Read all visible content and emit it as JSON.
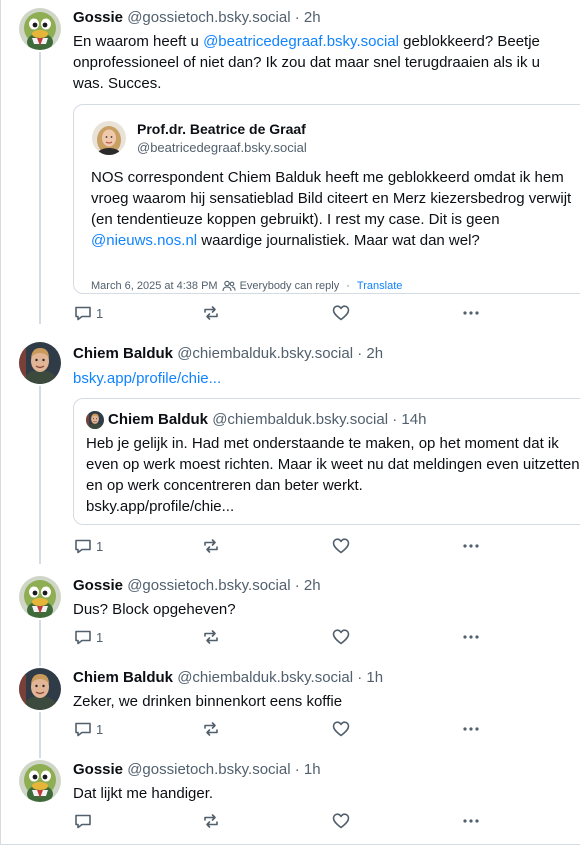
{
  "colors": {
    "accent": "#1083fe",
    "muted": "#52606d",
    "border": "#d4dbe2"
  },
  "posts": [
    {
      "name": "Gossie",
      "handle": "@gossietoch.bsky.social",
      "time": "2h",
      "text_parts": [
        "En waarom heeft u ",
        "@beatricedegraaf.bsky.social",
        " geblokkeerd? Beetje onprofessioneel of niet dan? Ik zou dat maar snel terugdraaien als ik u was. Succes."
      ],
      "quote": {
        "name": "Prof.dr. Beatrice de Graaf",
        "handle": "@beatricedegraaf.bsky.social",
        "text_parts": [
          "NOS correspondent Chiem Balduk heeft me geblokkeerd omdat ik hem vroeg waarom hij sensatieblad Bild citeert en Merz kiezersbedrog verwijt (en tendentieuze koppen gebruikt). I rest my case. Dit is geen ",
          "@nieuws.nos.nl",
          " waardige journalistiek. Maar wat dan wel?"
        ],
        "date": "March 6, 2025 at 4:38 PM",
        "reply_setting": "Everybody can reply",
        "translate": "Translate"
      },
      "reply_count": "1",
      "avatar_icon": "duck-mascot-avatar"
    },
    {
      "name": "Chiem Balduk",
      "handle": "@chiembalduk.bsky.social",
      "time": "2h",
      "link": "bsky.app/profile/chie...",
      "quote": {
        "name": "Chiem Balduk",
        "handle": "@chiembalduk.bsky.social",
        "time": "14h",
        "text": "Heb je gelijk in. Had met onderstaande te maken, op het moment dat ik even op werk moest richten. Maar ik weet nu dat meldingen even uitzetten en op werk concentreren dan beter werkt.",
        "link": "bsky.app/profile/chie..."
      },
      "reply_count": "1",
      "avatar_icon": "man-portrait-avatar"
    },
    {
      "name": "Gossie",
      "handle": "@gossietoch.bsky.social",
      "time": "2h",
      "text": "Dus? Block opgeheven?",
      "reply_count": "1",
      "avatar_icon": "duck-mascot-avatar"
    },
    {
      "name": "Chiem Balduk",
      "handle": "@chiembalduk.bsky.social",
      "time": "1h",
      "text": "Zeker, we drinken binnenkort eens koffie",
      "reply_count": "1",
      "avatar_icon": "man-portrait-avatar"
    },
    {
      "name": "Gossie",
      "handle": "@gossietoch.bsky.social",
      "time": "1h",
      "text": "Dat lijkt me handiger.",
      "reply_count": "",
      "avatar_icon": "duck-mascot-avatar"
    }
  ],
  "separator": "·"
}
